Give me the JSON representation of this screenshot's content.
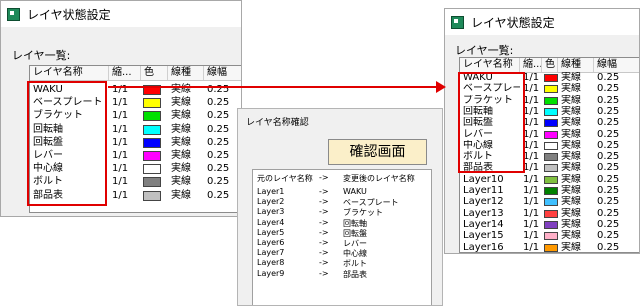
{
  "left_window": {
    "title": "レイヤ状態設定",
    "group_label": "レイヤ一覧:",
    "columns": [
      "レイヤ名称",
      "縮...",
      "色",
      "線種",
      "線幅"
    ],
    "rows": [
      {
        "name": "WAKU",
        "scale": "1/1",
        "color": "#ff0000",
        "line": "実線",
        "width": "0.25"
      },
      {
        "name": "ベースプレート",
        "scale": "1/1",
        "color": "#ffff00",
        "line": "実線",
        "width": "0.25"
      },
      {
        "name": "ブラケット",
        "scale": "1/1",
        "color": "#00e000",
        "line": "実線",
        "width": "0.25"
      },
      {
        "name": "回転軸",
        "scale": "1/1",
        "color": "#00ffff",
        "line": "実線",
        "width": "0.25"
      },
      {
        "name": "回転盤",
        "scale": "1/1",
        "color": "#0000ff",
        "line": "実線",
        "width": "0.25"
      },
      {
        "name": "レバー",
        "scale": "1/1",
        "color": "#ff00ff",
        "line": "実線",
        "width": "0.25"
      },
      {
        "name": "中心線",
        "scale": "1/1",
        "color": "#ffffff",
        "line": "実線",
        "width": "0.25"
      },
      {
        "name": "ボルト",
        "scale": "1/1",
        "color": "#808080",
        "line": "実線",
        "width": "0.25"
      },
      {
        "name": "部品表",
        "scale": "1/1",
        "color": "#c0c0c0",
        "line": "実線",
        "width": "0.25"
      }
    ]
  },
  "right_window": {
    "title": "レイヤ状態設定",
    "group_label": "レイヤ一覧:",
    "columns": [
      "レイヤ名称",
      "縮...",
      "色",
      "線種",
      "線幅"
    ],
    "rows": [
      {
        "name": "WAKU",
        "scale": "1/1",
        "color": "#ff0000",
        "line": "実線",
        "width": "0.25"
      },
      {
        "name": "ベースプレート",
        "scale": "1/1",
        "color": "#ffff00",
        "line": "実線",
        "width": "0.25"
      },
      {
        "name": "ブラケット",
        "scale": "1/1",
        "color": "#00e000",
        "line": "実線",
        "width": "0.25"
      },
      {
        "name": "回転軸",
        "scale": "1/1",
        "color": "#00ffff",
        "line": "実線",
        "width": "0.25"
      },
      {
        "name": "回転盤",
        "scale": "1/1",
        "color": "#0000ff",
        "line": "実線",
        "width": "0.25"
      },
      {
        "name": "レバー",
        "scale": "1/1",
        "color": "#ff00ff",
        "line": "実線",
        "width": "0.25"
      },
      {
        "name": "中心線",
        "scale": "1/1",
        "color": "#ffffff",
        "line": "実線",
        "width": "0.25"
      },
      {
        "name": "ボルト",
        "scale": "1/1",
        "color": "#808080",
        "line": "実線",
        "width": "0.25"
      },
      {
        "name": "部品表",
        "scale": "1/1",
        "color": "#c0c0c0",
        "line": "実線",
        "width": "0.25"
      },
      {
        "name": "Layer10",
        "scale": "1/1",
        "color": "#80c040",
        "line": "実線",
        "width": "0.25"
      },
      {
        "name": "Layer11",
        "scale": "1/1",
        "color": "#008000",
        "line": "実線",
        "width": "0.25"
      },
      {
        "name": "Layer12",
        "scale": "1/1",
        "color": "#40c0ff",
        "line": "実線",
        "width": "0.25"
      },
      {
        "name": "Layer13",
        "scale": "1/1",
        "color": "#ff4040",
        "line": "実線",
        "width": "0.25"
      },
      {
        "name": "Layer14",
        "scale": "1/1",
        "color": "#8040c0",
        "line": "実線",
        "width": "0.25"
      },
      {
        "name": "Layer15",
        "scale": "1/1",
        "color": "#ffb0c8",
        "line": "実線",
        "width": "0.25"
      },
      {
        "name": "Layer16",
        "scale": "1/1",
        "color": "#ff9900",
        "line": "実線",
        "width": "0.25"
      }
    ]
  },
  "dialog": {
    "title": "レイヤ名称確認",
    "banner": "確認画面",
    "header": {
      "from": "元のレイヤ名称",
      "arrow": "->",
      "to": "変更後のレイヤ名称"
    },
    "rows": [
      {
        "from": "Layer1",
        "arrow": "->",
        "to": "WAKU"
      },
      {
        "from": "Layer2",
        "arrow": "->",
        "to": "ベースプレート"
      },
      {
        "from": "Layer3",
        "arrow": "->",
        "to": "ブラケット"
      },
      {
        "from": "Layer4",
        "arrow": "->",
        "to": "回転軸"
      },
      {
        "from": "Layer5",
        "arrow": "->",
        "to": "回転盤"
      },
      {
        "from": "Layer6",
        "arrow": "->",
        "to": "レバー"
      },
      {
        "from": "Layer7",
        "arrow": "->",
        "to": "中心線"
      },
      {
        "from": "Layer8",
        "arrow": "->",
        "to": "ボルト"
      },
      {
        "from": "Layer9",
        "arrow": "->",
        "to": "部品表"
      }
    ]
  },
  "highlight_color": "#e00000"
}
